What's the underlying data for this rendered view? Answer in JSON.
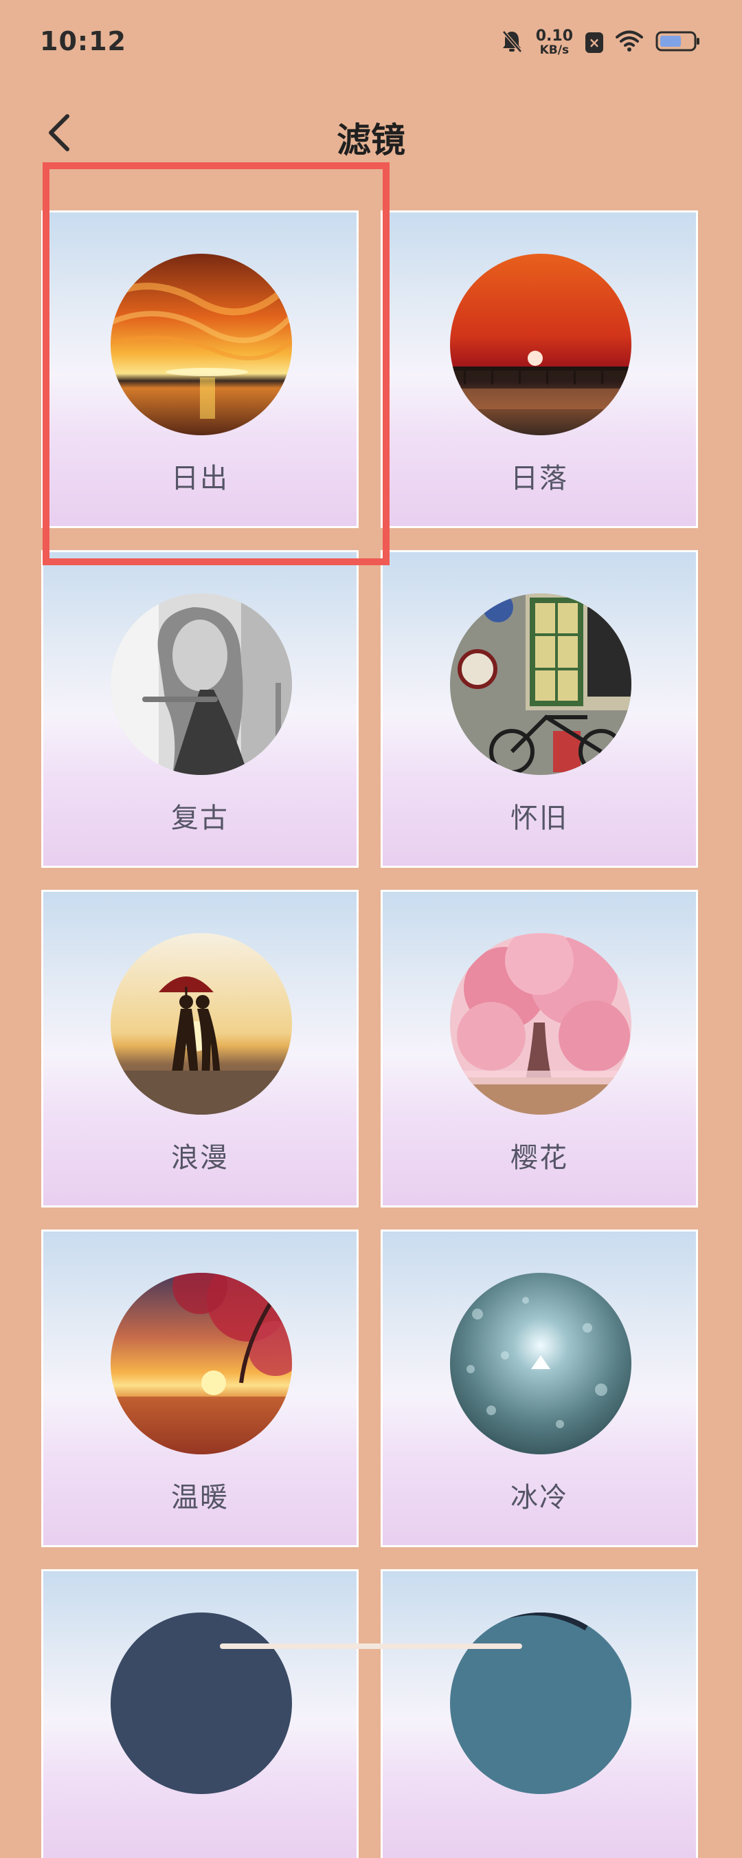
{
  "status_bar": {
    "time": "10:12",
    "net_speed_value": "0.10",
    "net_speed_unit": "KB/s",
    "icons": [
      "mute-bell-icon",
      "close-notification-icon",
      "wifi-icon",
      "battery-icon"
    ]
  },
  "header": {
    "title": "滤镜",
    "back_icon": "chevron-left-icon"
  },
  "filters": [
    {
      "label": "日出",
      "image": "sunrise-thumbnail",
      "selected": true
    },
    {
      "label": "日落",
      "image": "sunset-thumbnail",
      "selected": false
    },
    {
      "label": "复古",
      "image": "retro-portrait-thumbnail",
      "selected": false
    },
    {
      "label": "怀旧",
      "image": "nostalgic-bicycle-thumbnail",
      "selected": false
    },
    {
      "label": "浪漫",
      "image": "romantic-couple-thumbnail",
      "selected": false
    },
    {
      "label": "樱花",
      "image": "cherry-blossom-thumbnail",
      "selected": false
    },
    {
      "label": "温暖",
      "image": "warm-sunset-thumbnail",
      "selected": false
    },
    {
      "label": "冰冷",
      "image": "cold-rain-thumbnail",
      "selected": false
    }
  ],
  "colors": {
    "background": "#E7B394",
    "highlight": "#EF5A54",
    "card_border": "#FFFFFF"
  }
}
